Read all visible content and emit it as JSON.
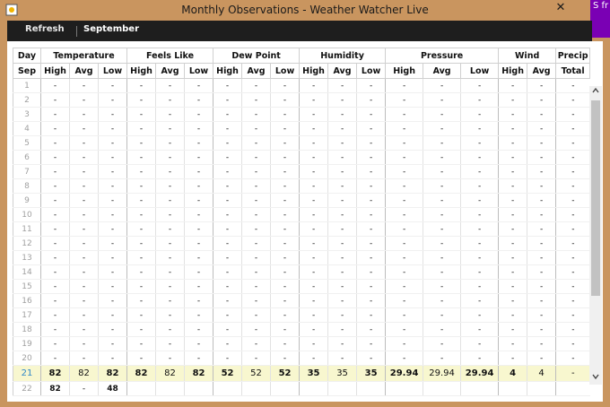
{
  "window": {
    "title": "Monthly Observations - Weather Watcher Live",
    "close_label": "✕"
  },
  "overlay": {
    "text": "S fr"
  },
  "toolbar": {
    "refresh_label": "Refresh",
    "month_label": "September"
  },
  "table": {
    "group_headers": [
      "Day",
      "Temperature",
      "Feels Like",
      "Dew Point",
      "Humidity",
      "Pressure",
      "Wind",
      "Precip"
    ],
    "sub_headers": [
      "Sep",
      "High",
      "Avg",
      "Low",
      "High",
      "Avg",
      "Low",
      "High",
      "Avg",
      "Low",
      "High",
      "Avg",
      "Low",
      "High",
      "Avg",
      "Low",
      "High",
      "Avg",
      "Total"
    ],
    "rows": [
      {
        "day": "1",
        "cells": [
          "-",
          "-",
          "-",
          "-",
          "-",
          "-",
          "-",
          "-",
          "-",
          "-",
          "-",
          "-",
          "-",
          "-",
          "-",
          "-",
          "-",
          "-"
        ]
      },
      {
        "day": "2",
        "cells": [
          "-",
          "-",
          "-",
          "-",
          "-",
          "-",
          "-",
          "-",
          "-",
          "-",
          "-",
          "-",
          "-",
          "-",
          "-",
          "-",
          "-",
          "-"
        ]
      },
      {
        "day": "3",
        "cells": [
          "-",
          "-",
          "-",
          "-",
          "-",
          "-",
          "-",
          "-",
          "-",
          "-",
          "-",
          "-",
          "-",
          "-",
          "-",
          "-",
          "-",
          "-"
        ]
      },
      {
        "day": "4",
        "cells": [
          "-",
          "-",
          "-",
          "-",
          "-",
          "-",
          "-",
          "-",
          "-",
          "-",
          "-",
          "-",
          "-",
          "-",
          "-",
          "-",
          "-",
          "-"
        ]
      },
      {
        "day": "5",
        "cells": [
          "-",
          "-",
          "-",
          "-",
          "-",
          "-",
          "-",
          "-",
          "-",
          "-",
          "-",
          "-",
          "-",
          "-",
          "-",
          "-",
          "-",
          "-"
        ]
      },
      {
        "day": "6",
        "cells": [
          "-",
          "-",
          "-",
          "-",
          "-",
          "-",
          "-",
          "-",
          "-",
          "-",
          "-",
          "-",
          "-",
          "-",
          "-",
          "-",
          "-",
          "-"
        ]
      },
      {
        "day": "7",
        "cells": [
          "-",
          "-",
          "-",
          "-",
          "-",
          "-",
          "-",
          "-",
          "-",
          "-",
          "-",
          "-",
          "-",
          "-",
          "-",
          "-",
          "-",
          "-"
        ]
      },
      {
        "day": "8",
        "cells": [
          "-",
          "-",
          "-",
          "-",
          "-",
          "-",
          "-",
          "-",
          "-",
          "-",
          "-",
          "-",
          "-",
          "-",
          "-",
          "-",
          "-",
          "-"
        ]
      },
      {
        "day": "9",
        "cells": [
          "-",
          "-",
          "-",
          "-",
          "-",
          "-",
          "-",
          "-",
          "-",
          "-",
          "-",
          "-",
          "-",
          "-",
          "-",
          "-",
          "-",
          "-"
        ]
      },
      {
        "day": "10",
        "cells": [
          "-",
          "-",
          "-",
          "-",
          "-",
          "-",
          "-",
          "-",
          "-",
          "-",
          "-",
          "-",
          "-",
          "-",
          "-",
          "-",
          "-",
          "-"
        ]
      },
      {
        "day": "11",
        "cells": [
          "-",
          "-",
          "-",
          "-",
          "-",
          "-",
          "-",
          "-",
          "-",
          "-",
          "-",
          "-",
          "-",
          "-",
          "-",
          "-",
          "-",
          "-"
        ]
      },
      {
        "day": "12",
        "cells": [
          "-",
          "-",
          "-",
          "-",
          "-",
          "-",
          "-",
          "-",
          "-",
          "-",
          "-",
          "-",
          "-",
          "-",
          "-",
          "-",
          "-",
          "-"
        ]
      },
      {
        "day": "13",
        "cells": [
          "-",
          "-",
          "-",
          "-",
          "-",
          "-",
          "-",
          "-",
          "-",
          "-",
          "-",
          "-",
          "-",
          "-",
          "-",
          "-",
          "-",
          "-"
        ]
      },
      {
        "day": "14",
        "cells": [
          "-",
          "-",
          "-",
          "-",
          "-",
          "-",
          "-",
          "-",
          "-",
          "-",
          "-",
          "-",
          "-",
          "-",
          "-",
          "-",
          "-",
          "-"
        ]
      },
      {
        "day": "15",
        "cells": [
          "-",
          "-",
          "-",
          "-",
          "-",
          "-",
          "-",
          "-",
          "-",
          "-",
          "-",
          "-",
          "-",
          "-",
          "-",
          "-",
          "-",
          "-"
        ]
      },
      {
        "day": "16",
        "cells": [
          "-",
          "-",
          "-",
          "-",
          "-",
          "-",
          "-",
          "-",
          "-",
          "-",
          "-",
          "-",
          "-",
          "-",
          "-",
          "-",
          "-",
          "-"
        ]
      },
      {
        "day": "17",
        "cells": [
          "-",
          "-",
          "-",
          "-",
          "-",
          "-",
          "-",
          "-",
          "-",
          "-",
          "-",
          "-",
          "-",
          "-",
          "-",
          "-",
          "-",
          "-"
        ]
      },
      {
        "day": "18",
        "cells": [
          "-",
          "-",
          "-",
          "-",
          "-",
          "-",
          "-",
          "-",
          "-",
          "-",
          "-",
          "-",
          "-",
          "-",
          "-",
          "-",
          "-",
          "-"
        ]
      },
      {
        "day": "19",
        "cells": [
          "-",
          "-",
          "-",
          "-",
          "-",
          "-",
          "-",
          "-",
          "-",
          "-",
          "-",
          "-",
          "-",
          "-",
          "-",
          "-",
          "-",
          "-"
        ]
      },
      {
        "day": "20",
        "cells": [
          "-",
          "-",
          "-",
          "-",
          "-",
          "-",
          "-",
          "-",
          "-",
          "-",
          "-",
          "-",
          "-",
          "-",
          "-",
          "-",
          "-",
          "-"
        ]
      },
      {
        "day": "21",
        "highlight": true,
        "cells": [
          "82",
          "82",
          "82",
          "82",
          "82",
          "82",
          "52",
          "52",
          "52",
          "35",
          "35",
          "35",
          "29.94",
          "29.94",
          "29.94",
          "4",
          "4",
          "-"
        ]
      },
      {
        "day": "22",
        "cells": [
          "82",
          "-",
          "48",
          "",
          "",
          "",
          "",
          "",
          "",
          "",
          "",
          "",
          "",
          "",
          "",
          "",
          "",
          ""
        ]
      }
    ]
  },
  "colors": {
    "high": "#c0161c",
    "low": "#1e64b4",
    "highlight_row": "#f8f7cf",
    "toolbar_bg": "#1e1e1e",
    "window_frame": "#c9955f"
  },
  "icons": {
    "app": "weather-app-icon",
    "scroll_up": "chevron-up-icon",
    "scroll_down": "chevron-down-icon",
    "close": "close-icon"
  }
}
